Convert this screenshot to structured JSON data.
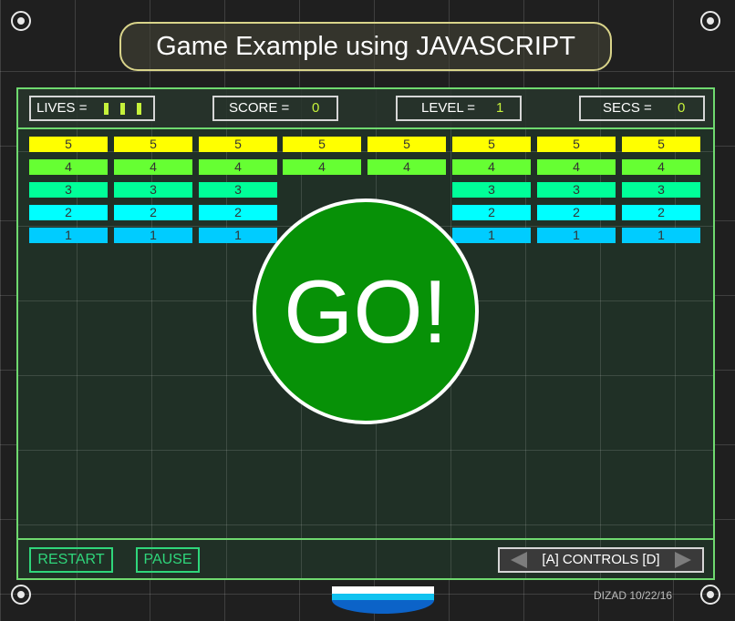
{
  "title": "Game Example using JAVASCRIPT",
  "hud": {
    "lives_label": "LIVES =",
    "lives_count": 3,
    "score_label": "SCORE =",
    "score_value": "0",
    "level_label": "LEVEL =",
    "level_value": "1",
    "secs_label": "SECS =",
    "secs_value": "0"
  },
  "bricks": {
    "columns": 8,
    "rows": [
      {
        "label": "5",
        "color": "#ffff00"
      },
      {
        "label": "4",
        "color": "#66ff33"
      },
      {
        "label": "3",
        "color": "#00ff99"
      },
      {
        "label": "2",
        "color": "#00ffff"
      },
      {
        "label": "1",
        "color": "#00ccff"
      }
    ],
    "hidden": [
      [
        3,
        2
      ],
      [
        4,
        2
      ],
      [
        3,
        3
      ],
      [
        4,
        3
      ],
      [
        3,
        4
      ],
      [
        4,
        4
      ]
    ]
  },
  "overlay": {
    "text": "GO!",
    "color": "#079107"
  },
  "footer": {
    "restart_label": "RESTART",
    "pause_label": "PAUSE",
    "controls_label": "[A]  CONTROLS  [D]"
  },
  "credit": "DIZAD 10/22/16",
  "colors": {
    "accent_green": "#6fd96f",
    "button_green": "#2fd67b",
    "hud_value": "#c6f23b"
  }
}
